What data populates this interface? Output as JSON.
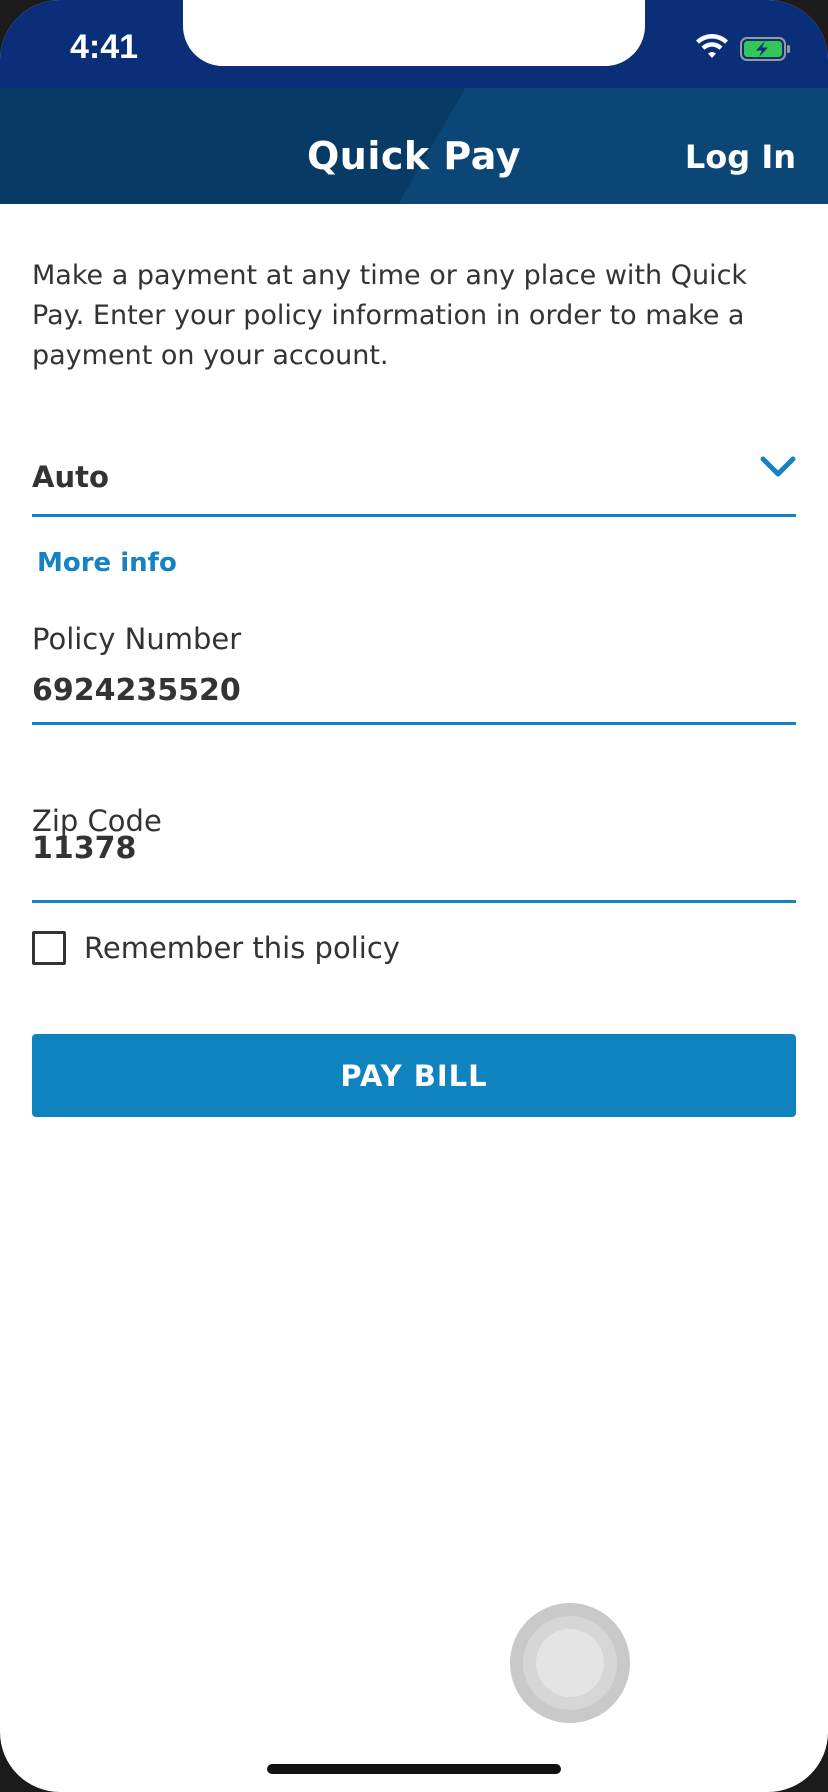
{
  "status_bar": {
    "time": "4:41",
    "icons": [
      "wifi-icon",
      "battery-charging-icon"
    ]
  },
  "nav": {
    "title": "Quick Pay",
    "login_label": "Log In"
  },
  "intro_text": "Make a payment at any time or any place with Quick Pay. Enter your policy information in order to make a payment on your account.",
  "policy_type": {
    "selected": "Auto",
    "icon": "chevron-down-icon"
  },
  "more_info_label": "More info",
  "policy_number": {
    "label": "Policy Number",
    "value": "6924235520"
  },
  "zip_code": {
    "label": "Zip Code",
    "value": "11378"
  },
  "remember": {
    "label": "Remember this policy",
    "checked": false
  },
  "pay_button_label": "PAY BILL",
  "colors": {
    "status_bar": "#0a2f78",
    "nav_bar": "#083a66",
    "accent": "#1582c1",
    "button": "#0e83bd",
    "text": "#333333"
  }
}
